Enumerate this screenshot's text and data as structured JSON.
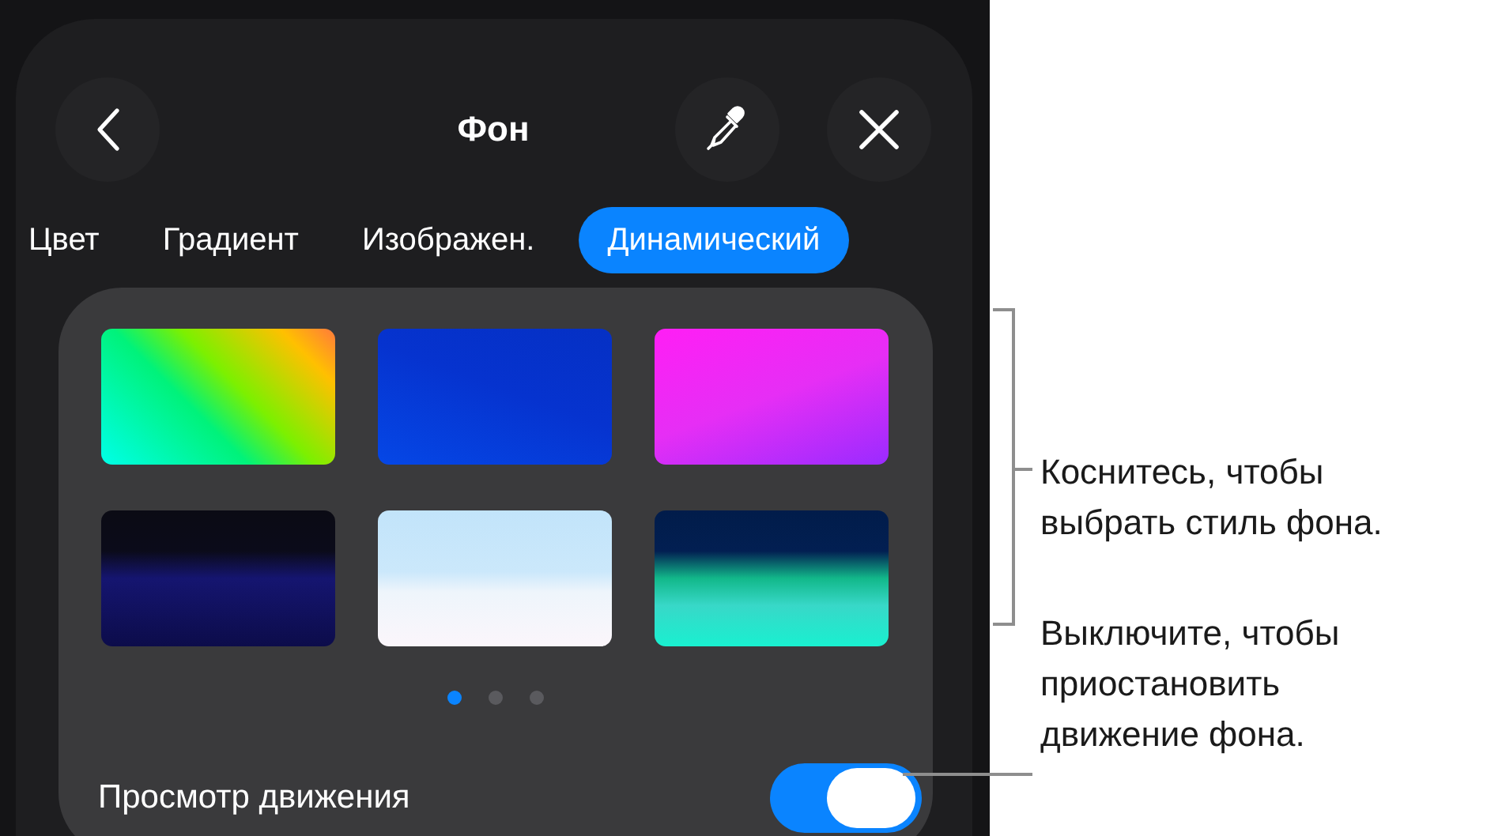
{
  "header": {
    "title": "Фон"
  },
  "tabs": [
    {
      "label": "Цвет",
      "selected": false
    },
    {
      "label": "Градиент",
      "selected": false
    },
    {
      "label": "Изображен.",
      "selected": false
    },
    {
      "label": "Динамический",
      "selected": true
    }
  ],
  "page_dots": [
    {
      "selected": true
    },
    {
      "selected": false
    },
    {
      "selected": false
    }
  ],
  "motion_toggle": {
    "label": "Просмотр движения",
    "on": true
  },
  "callouts": [
    {
      "lines": [
        "Коснитесь, чтобы",
        "выбрать стиль фона."
      ]
    },
    {
      "lines": [
        "Выключите, чтобы",
        "приостановить",
        "движение фона."
      ]
    }
  ]
}
